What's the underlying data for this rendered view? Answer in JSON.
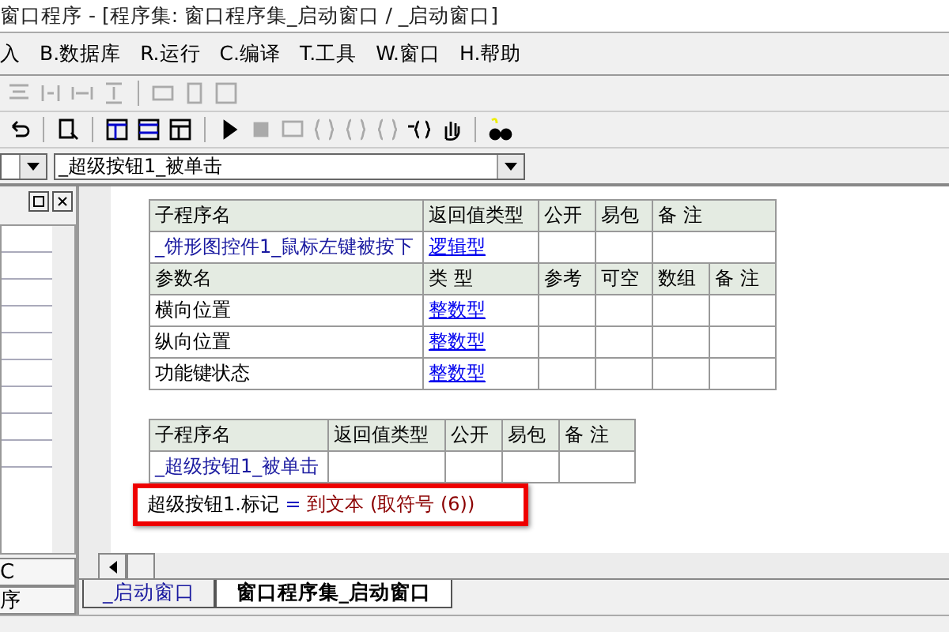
{
  "window": {
    "title": "窗口程序 - [程序集: 窗口程序集_启动窗口 / _启动窗口]"
  },
  "menu": [
    "入",
    "B.数据库",
    "R.运行",
    "C.编译",
    "T.工具",
    "W.窗口",
    "H.帮助"
  ],
  "event_combo": {
    "value": "_超级按钮1_被单击"
  },
  "side_tabs": [
    "C",
    "序"
  ],
  "sub1": {
    "header": [
      "子程序名",
      "返回值类型",
      "公开",
      "易包",
      "备 注"
    ],
    "name": "_饼形图控件1_鼠标左键被按下",
    "return_type": "逻辑型",
    "param_header": [
      "参数名",
      "类 型",
      "参考",
      "可空",
      "数组",
      "备 注"
    ],
    "params": [
      {
        "name": "横向位置",
        "type": "整数型"
      },
      {
        "name": "纵向位置",
        "type": "整数型"
      },
      {
        "name": "功能键状态",
        "type": "整数型"
      }
    ]
  },
  "sub2": {
    "header": [
      "子程序名",
      "返回值类型",
      "公开",
      "易包",
      "备 注"
    ],
    "name": "_超级按钮1_被单击"
  },
  "code_line": {
    "target": "超级按钮1.标记",
    "operator": "=",
    "expression": "到文本 (取符号 (6))"
  },
  "doc_tabs": [
    {
      "label": "_启动窗口",
      "selected": false
    },
    {
      "label": "窗口程序集_启动窗口",
      "selected": true
    }
  ]
}
